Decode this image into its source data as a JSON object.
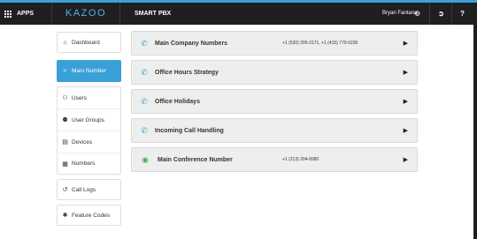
{
  "header": {
    "apps_label": "APPS",
    "logo": "KAZOO",
    "app_title": "SMART PBX",
    "user_name": "Bryan Fantana"
  },
  "sidebar": {
    "items": [
      {
        "label": "Dashboard",
        "icon": "home-icon"
      },
      {
        "label": "Main Number",
        "icon": "signal-icon",
        "active": true
      },
      {
        "label": "Users",
        "icon": "users-icon"
      },
      {
        "label": "User Groups",
        "icon": "group-icon"
      },
      {
        "label": "Devices",
        "icon": "devices-icon"
      },
      {
        "label": "Numbers",
        "icon": "numbers-grid-icon"
      },
      {
        "label": "Call Logs",
        "icon": "call-log-icon"
      },
      {
        "label": "Feature Codes",
        "icon": "asterisk-icon"
      }
    ]
  },
  "main": {
    "rows": [
      {
        "label": "Main Company Numbers",
        "value": "+1 (530) 205-3171, +1 (415) 779-0236",
        "icon": "phone-icon"
      },
      {
        "label": "Office Hours Strategy",
        "value": "",
        "icon": "phone-icon"
      },
      {
        "label": "Office Holidays",
        "value": "",
        "icon": "phone-icon"
      },
      {
        "label": "Incoming Call Handling",
        "value": "",
        "icon": "phone-icon"
      },
      {
        "label": "Main Conference Number",
        "value": "+1 (213) 204-9980",
        "icon": "conference-chat-icon"
      }
    ]
  },
  "colors": {
    "accent": "#3aa0d8",
    "topbar": "#1f1f1f",
    "row_bg": "#eeeeee",
    "conference": "#4caf50"
  }
}
